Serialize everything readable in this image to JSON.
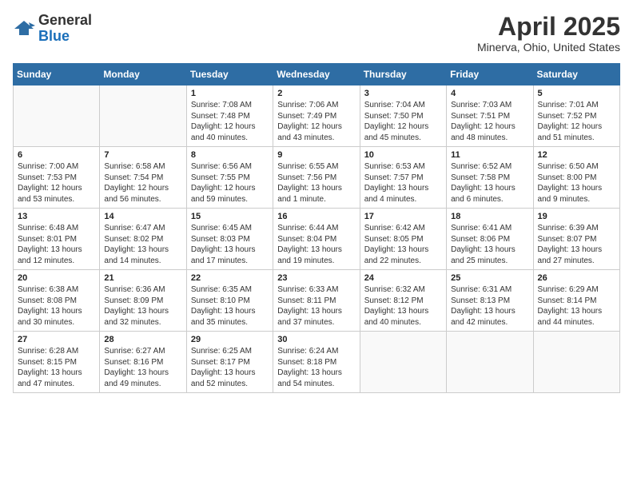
{
  "header": {
    "logo_general": "General",
    "logo_blue": "Blue",
    "month": "April 2025",
    "location": "Minerva, Ohio, United States"
  },
  "weekdays": [
    "Sunday",
    "Monday",
    "Tuesday",
    "Wednesday",
    "Thursday",
    "Friday",
    "Saturday"
  ],
  "weeks": [
    [
      {
        "day": "",
        "info": ""
      },
      {
        "day": "",
        "info": ""
      },
      {
        "day": "1",
        "info": "Sunrise: 7:08 AM\nSunset: 7:48 PM\nDaylight: 12 hours and 40 minutes."
      },
      {
        "day": "2",
        "info": "Sunrise: 7:06 AM\nSunset: 7:49 PM\nDaylight: 12 hours and 43 minutes."
      },
      {
        "day": "3",
        "info": "Sunrise: 7:04 AM\nSunset: 7:50 PM\nDaylight: 12 hours and 45 minutes."
      },
      {
        "day": "4",
        "info": "Sunrise: 7:03 AM\nSunset: 7:51 PM\nDaylight: 12 hours and 48 minutes."
      },
      {
        "day": "5",
        "info": "Sunrise: 7:01 AM\nSunset: 7:52 PM\nDaylight: 12 hours and 51 minutes."
      }
    ],
    [
      {
        "day": "6",
        "info": "Sunrise: 7:00 AM\nSunset: 7:53 PM\nDaylight: 12 hours and 53 minutes."
      },
      {
        "day": "7",
        "info": "Sunrise: 6:58 AM\nSunset: 7:54 PM\nDaylight: 12 hours and 56 minutes."
      },
      {
        "day": "8",
        "info": "Sunrise: 6:56 AM\nSunset: 7:55 PM\nDaylight: 12 hours and 59 minutes."
      },
      {
        "day": "9",
        "info": "Sunrise: 6:55 AM\nSunset: 7:56 PM\nDaylight: 13 hours and 1 minute."
      },
      {
        "day": "10",
        "info": "Sunrise: 6:53 AM\nSunset: 7:57 PM\nDaylight: 13 hours and 4 minutes."
      },
      {
        "day": "11",
        "info": "Sunrise: 6:52 AM\nSunset: 7:58 PM\nDaylight: 13 hours and 6 minutes."
      },
      {
        "day": "12",
        "info": "Sunrise: 6:50 AM\nSunset: 8:00 PM\nDaylight: 13 hours and 9 minutes."
      }
    ],
    [
      {
        "day": "13",
        "info": "Sunrise: 6:48 AM\nSunset: 8:01 PM\nDaylight: 13 hours and 12 minutes."
      },
      {
        "day": "14",
        "info": "Sunrise: 6:47 AM\nSunset: 8:02 PM\nDaylight: 13 hours and 14 minutes."
      },
      {
        "day": "15",
        "info": "Sunrise: 6:45 AM\nSunset: 8:03 PM\nDaylight: 13 hours and 17 minutes."
      },
      {
        "day": "16",
        "info": "Sunrise: 6:44 AM\nSunset: 8:04 PM\nDaylight: 13 hours and 19 minutes."
      },
      {
        "day": "17",
        "info": "Sunrise: 6:42 AM\nSunset: 8:05 PM\nDaylight: 13 hours and 22 minutes."
      },
      {
        "day": "18",
        "info": "Sunrise: 6:41 AM\nSunset: 8:06 PM\nDaylight: 13 hours and 25 minutes."
      },
      {
        "day": "19",
        "info": "Sunrise: 6:39 AM\nSunset: 8:07 PM\nDaylight: 13 hours and 27 minutes."
      }
    ],
    [
      {
        "day": "20",
        "info": "Sunrise: 6:38 AM\nSunset: 8:08 PM\nDaylight: 13 hours and 30 minutes."
      },
      {
        "day": "21",
        "info": "Sunrise: 6:36 AM\nSunset: 8:09 PM\nDaylight: 13 hours and 32 minutes."
      },
      {
        "day": "22",
        "info": "Sunrise: 6:35 AM\nSunset: 8:10 PM\nDaylight: 13 hours and 35 minutes."
      },
      {
        "day": "23",
        "info": "Sunrise: 6:33 AM\nSunset: 8:11 PM\nDaylight: 13 hours and 37 minutes."
      },
      {
        "day": "24",
        "info": "Sunrise: 6:32 AM\nSunset: 8:12 PM\nDaylight: 13 hours and 40 minutes."
      },
      {
        "day": "25",
        "info": "Sunrise: 6:31 AM\nSunset: 8:13 PM\nDaylight: 13 hours and 42 minutes."
      },
      {
        "day": "26",
        "info": "Sunrise: 6:29 AM\nSunset: 8:14 PM\nDaylight: 13 hours and 44 minutes."
      }
    ],
    [
      {
        "day": "27",
        "info": "Sunrise: 6:28 AM\nSunset: 8:15 PM\nDaylight: 13 hours and 47 minutes."
      },
      {
        "day": "28",
        "info": "Sunrise: 6:27 AM\nSunset: 8:16 PM\nDaylight: 13 hours and 49 minutes."
      },
      {
        "day": "29",
        "info": "Sunrise: 6:25 AM\nSunset: 8:17 PM\nDaylight: 13 hours and 52 minutes."
      },
      {
        "day": "30",
        "info": "Sunrise: 6:24 AM\nSunset: 8:18 PM\nDaylight: 13 hours and 54 minutes."
      },
      {
        "day": "",
        "info": ""
      },
      {
        "day": "",
        "info": ""
      },
      {
        "day": "",
        "info": ""
      }
    ]
  ]
}
